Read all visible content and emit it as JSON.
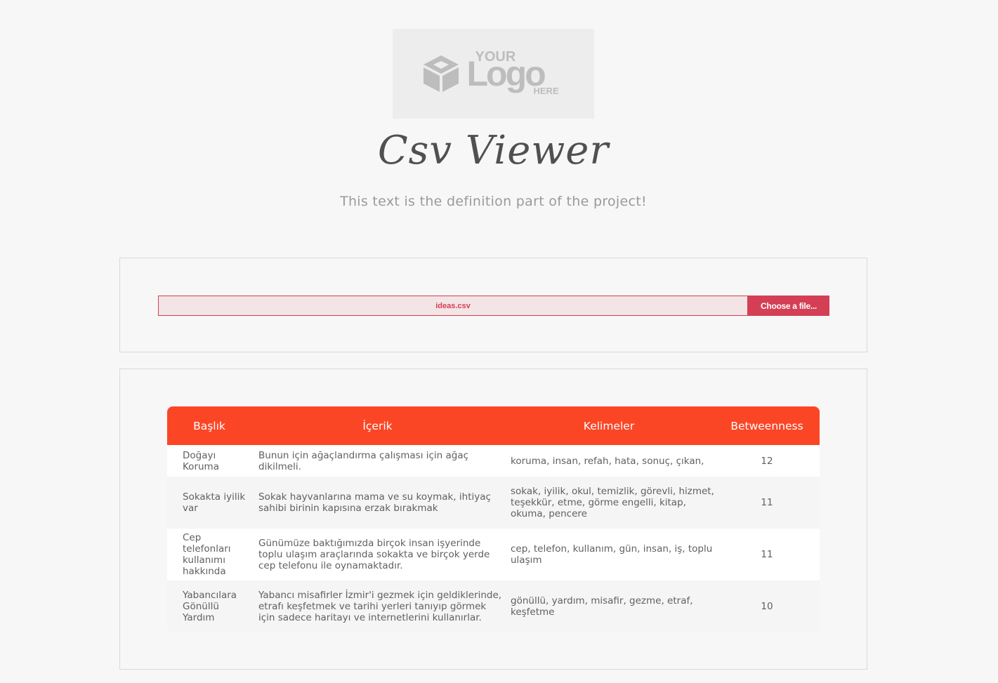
{
  "logo": {
    "your": "YOUR",
    "main": "Logo",
    "here": "HERE",
    "icon": "cube-icon"
  },
  "header": {
    "title": "Csv Viewer",
    "subtitle": "This text is the definition part of the project!"
  },
  "upload": {
    "file_name": "ideas.csv",
    "button_label": "Choose a file...",
    "accent_color": "#d43f55"
  },
  "table": {
    "header_color": "#fb4626",
    "columns": [
      "Başlık",
      "İçerik",
      "Kelimeler",
      "Betweenness"
    ],
    "rows": [
      {
        "baslik": "Doğayı Koruma",
        "icerik": "Bunun için ağaçlandırma çalışması için ağaç dikilmeli.",
        "kelimeler": "koruma, insan, refah, hata, sonuç, çıkan,",
        "betweenness": "12"
      },
      {
        "baslik": "Sokakta iyilik var",
        "icerik": "Sokak hayvanlarına mama ve su koymak, ihtiyaç sahibi birinin kapısına erzak bırakmak",
        "kelimeler": "sokak, iyilik, okul, temizlik, görevli, hizmet, teşekkür, etme, görme engelli, kitap, okuma, pencere",
        "betweenness": "11"
      },
      {
        "baslik": "Cep telefonları kullanımı hakkında",
        "icerik": "Günümüze baktığımızda birçok insan işyerinde toplu ulaşım araçlarında sokakta ve birçok yerde cep telefonu ile oynamaktadır.",
        "kelimeler": "cep, telefon, kullanım, gün, insan, iş, toplu ulaşım",
        "betweenness": "11"
      },
      {
        "baslik": "Yabancılara Gönüllü Yardım",
        "icerik": "Yabancı misafirler İzmir'i gezmek için geldiklerinde, etrafı keşfetmek ve tarihi yerleri tanıyıp görmek için sadece haritayı ve internetlerini kullanırlar.",
        "kelimeler": "gönüllü, yardım, misafir, gezme, etraf, keşfetme",
        "betweenness": "10"
      }
    ]
  }
}
